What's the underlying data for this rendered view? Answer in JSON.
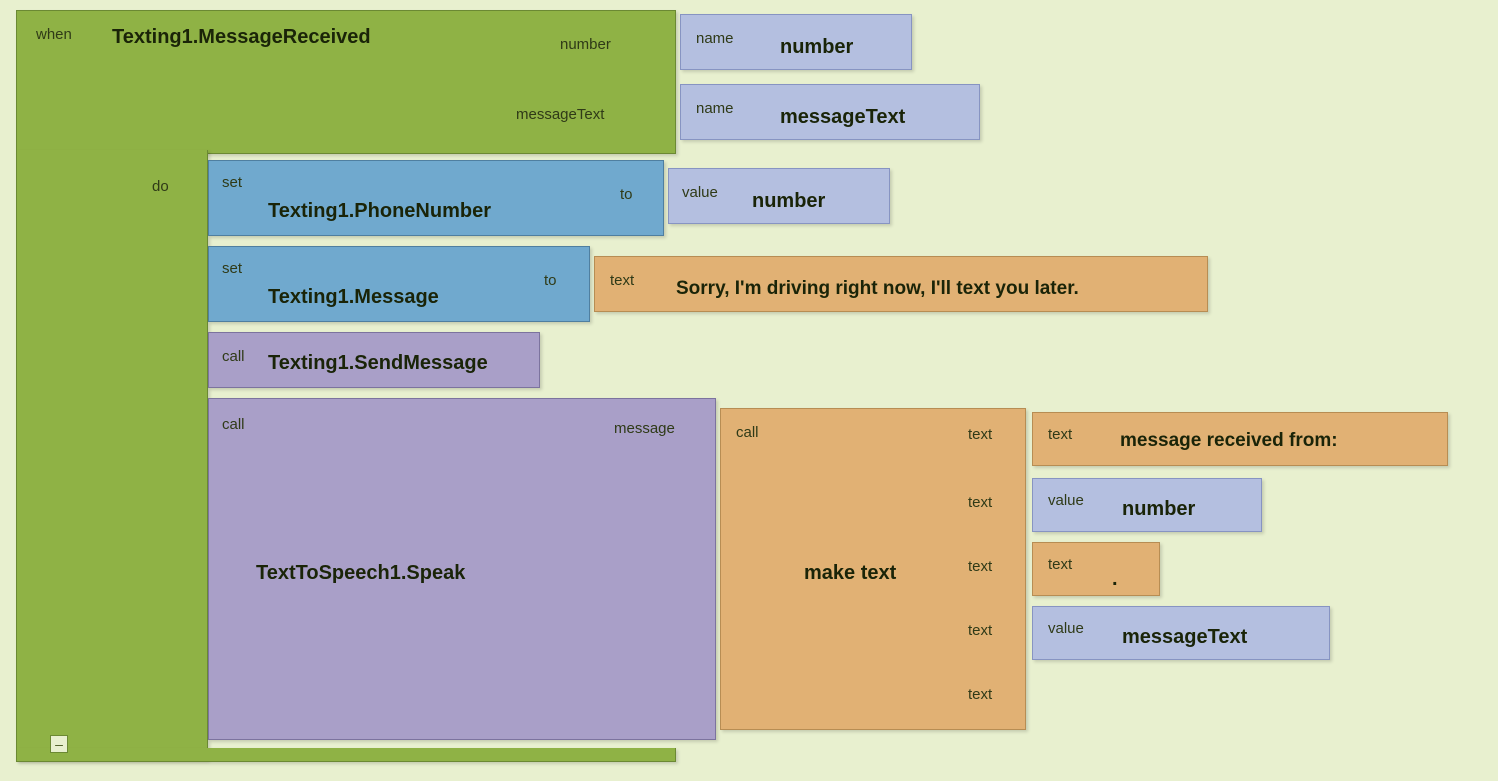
{
  "event": {
    "when": "when",
    "title": "Texting1.MessageReceived",
    "param1_kw": "number",
    "param1_name_kw": "name",
    "param1_name_val": "number",
    "param2_kw": "messageText",
    "param2_name_kw": "name",
    "param2_name_val": "messageText",
    "do_kw": "do"
  },
  "set1": {
    "set_kw": "set",
    "prop": "Texting1.PhoneNumber",
    "to_kw": "to",
    "val_kw": "value",
    "val": "number"
  },
  "set2": {
    "set_kw": "set",
    "prop": "Texting1.Message",
    "to_kw": "to",
    "txt_kw": "text",
    "txt": "Sorry, I'm driving right now, I'll text you later."
  },
  "call1": {
    "call_kw": "call",
    "method": "Texting1.SendMessage"
  },
  "call2": {
    "call_kw": "call",
    "method": "TextToSpeech1.Speak",
    "arg_kw": "message"
  },
  "maketext": {
    "call_kw": "call",
    "title": "make text",
    "slot_kw": "text",
    "r1_kw": "text",
    "r1_val": "message received from:",
    "r2_kw": "value",
    "r2_val": "number",
    "r3_kw": "text",
    "r3_val": ".",
    "r4_kw": "value",
    "r4_val": "messageText"
  },
  "collapse": "–"
}
